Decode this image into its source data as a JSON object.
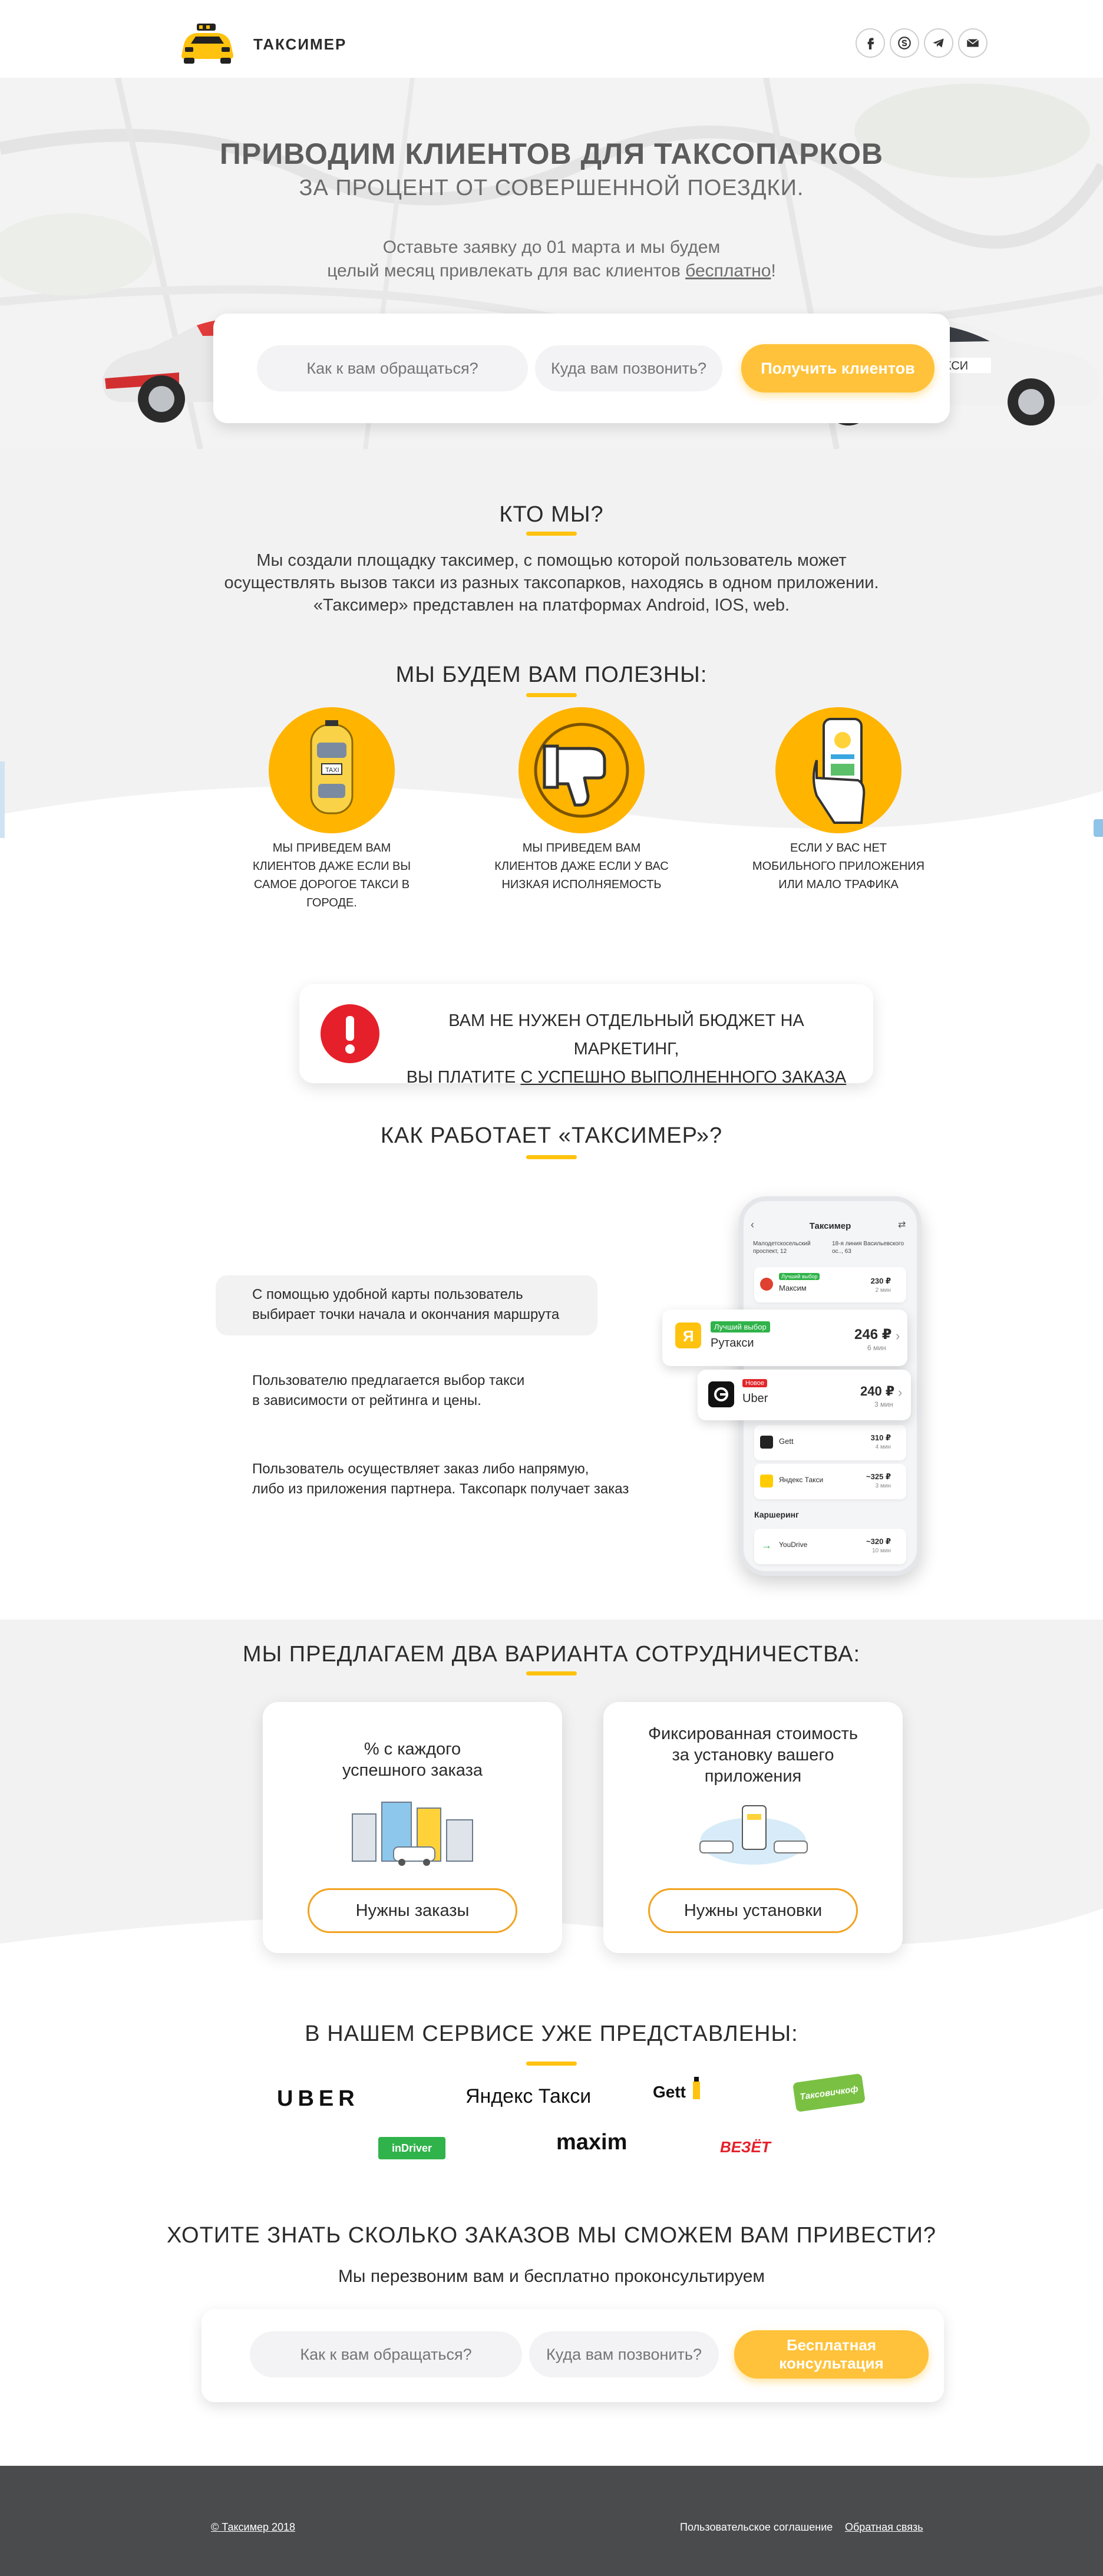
{
  "header": {
    "brand": "ТАКСИМЕР",
    "social_icons": [
      "facebook-icon",
      "skype-icon",
      "telegram-icon",
      "mail-icon"
    ]
  },
  "hero": {
    "title": "ПРИВОДИМ КЛИЕНТОВ ДЛЯ ТАКСОПАРКОВ",
    "subtitle": "ЗА ПРОЦЕНТ ОТ СОВЕРШЕННОЙ ПОЕЗДКИ.",
    "note_line1": "Оставьте заявку до 01 марта и мы будем",
    "note_line2_prefix": "целый месяц привлекать для вас клиентов ",
    "note_line2_link": "бесплатно",
    "note_line2_suffix": "!",
    "name_placeholder": "Как к вам обращаться?",
    "phone_placeholder": "Куда вам позвонить?",
    "cta": "Получить клиентов",
    "car_sign": "ТАКСИ"
  },
  "who": {
    "title": "КТО МЫ?",
    "text_line1": "Мы создали площадку таксимер, с помощью которой пользователь может",
    "text_line2": "осуществлять вызов такси из разных таксопарков, находясь в одном приложении.",
    "text_line3": "«Таксимер» представлен на платформах Android, IOS, web."
  },
  "useful": {
    "title": "МЫ БУДЕМ ВАМ ПОЛЕЗНЫ:",
    "items": [
      {
        "l1": "МЫ ПРИВЕДЕМ ВАМ",
        "l2": "КЛИЕНТОВ ДАЖЕ ЕСЛИ ВЫ",
        "l3": "САМОЕ ДОРОГОЕ ТАКСИ В",
        "l4": "ГОРОДЕ.",
        "icon": "taxi-car-icon"
      },
      {
        "l1": "МЫ ПРИВЕДЕМ ВАМ",
        "l2": "КЛИЕНТОВ ДАЖЕ ЕСЛИ У ВАС",
        "l3": "НИЗКАЯ ИСПОЛНЯЕМОСТЬ",
        "icon": "thumbs-down-icon"
      },
      {
        "l1": "ЕСЛИ У ВАС НЕТ",
        "l2": "МОБИЛЬНОГО ПРИЛОЖЕНИЯ",
        "l3": "ИЛИ МАЛО ТРАФИКА",
        "icon": "phone-in-hand-icon"
      }
    ]
  },
  "notice": {
    "line1": "ВАМ НЕ НУЖЕН ОТДЕЛЬНЫЙ БЮДЖЕТ НА МАРКЕТИНГ,",
    "line2_prefix": "ВЫ ПЛАТИТЕ ",
    "line2_link": "С УСПЕШНО ВЫПОЛНЕННОГО ЗАКАЗА",
    "icon": "exclamation-icon"
  },
  "how": {
    "title": "КАК РАБОТАЕТ «ТАКСИМЕР»?",
    "steps": [
      {
        "l1": "С помощью удобной карты пользователь",
        "l2": "выбирает точки начала и окончания маршрута"
      },
      {
        "l1": "Пользователю предлагается выбор такси",
        "l2": "в зависимости от рейтинга и цены."
      },
      {
        "l1": "Пользователь осуществляет заказ либо напрямую,",
        "l2": "либо из приложения партнера. Таксопарк получает заказ"
      }
    ],
    "phone": {
      "title": "Таксимер",
      "from": "Малодетскосельский проспект, 12",
      "to": "18-я линия Васильевского ос.., 63",
      "rows": [
        {
          "badge": "Лучший выбор",
          "name": "Максим",
          "price": "230 ₽",
          "eta": "2 мин"
        },
        {
          "name": "Gett",
          "price": "310 ₽",
          "eta": "4 мин"
        },
        {
          "name": "Яндекс Такси",
          "price": "~325 ₽",
          "eta": "3 мин"
        }
      ],
      "section": "Каршеринг",
      "car_row": {
        "name": "YouDrive",
        "price": "~320 ₽",
        "eta": "10 мин"
      }
    },
    "float1": {
      "badge": "Лучший выбор",
      "name": "Рутакси",
      "price": "246 ₽",
      "eta": "6 мин"
    },
    "float2": {
      "badge": "Новое",
      "name": "Uber",
      "price": "240 ₽",
      "eta": "3 мин"
    }
  },
  "offers": {
    "title": "МЫ ПРЕДЛАГАЕМ ДВА ВАРИАНТА СОТРУДНИЧЕСТВА:",
    "card1": {
      "l1": "% с каждого",
      "l2": "успешного заказа",
      "button": "Нужны заказы"
    },
    "card2": {
      "l1": "Фиксированная стоимость",
      "l2": "за установку вашего",
      "l3": "приложения",
      "button": "Нужны установки"
    }
  },
  "partners": {
    "title": "В НАШЕМ СЕРВИСЕ УЖЕ ПРЕДСТАВЛЕНЫ:",
    "uber": "UBER",
    "yandex": "Яндекс Такси",
    "gett": "Gett",
    "green": "Таксовичкоф",
    "indriver": "inDriver",
    "maxim": "maxim",
    "vezet": "ВЕЗЁТ"
  },
  "consult": {
    "title": "ХОТИТЕ ЗНАТЬ СКОЛЬКО ЗАКАЗОВ МЫ СМОЖЕМ ВАМ ПРИВЕСТИ?",
    "subtitle": "Мы перезвоним вам и бесплатно проконсультируем",
    "name_placeholder": "Как к вам обращаться?",
    "phone_placeholder": "Куда вам позвонить?",
    "cta": "Бесплатная консультация"
  },
  "footer": {
    "copyright": "© Таксимер 2018",
    "agreement": "Пользовательское соглашение",
    "feedback": "Обратная связь"
  },
  "colors": {
    "accent": "#ffc20e",
    "cta": "#ffc23a",
    "alert": "#e5202a",
    "footer": "#4a4b4d"
  }
}
